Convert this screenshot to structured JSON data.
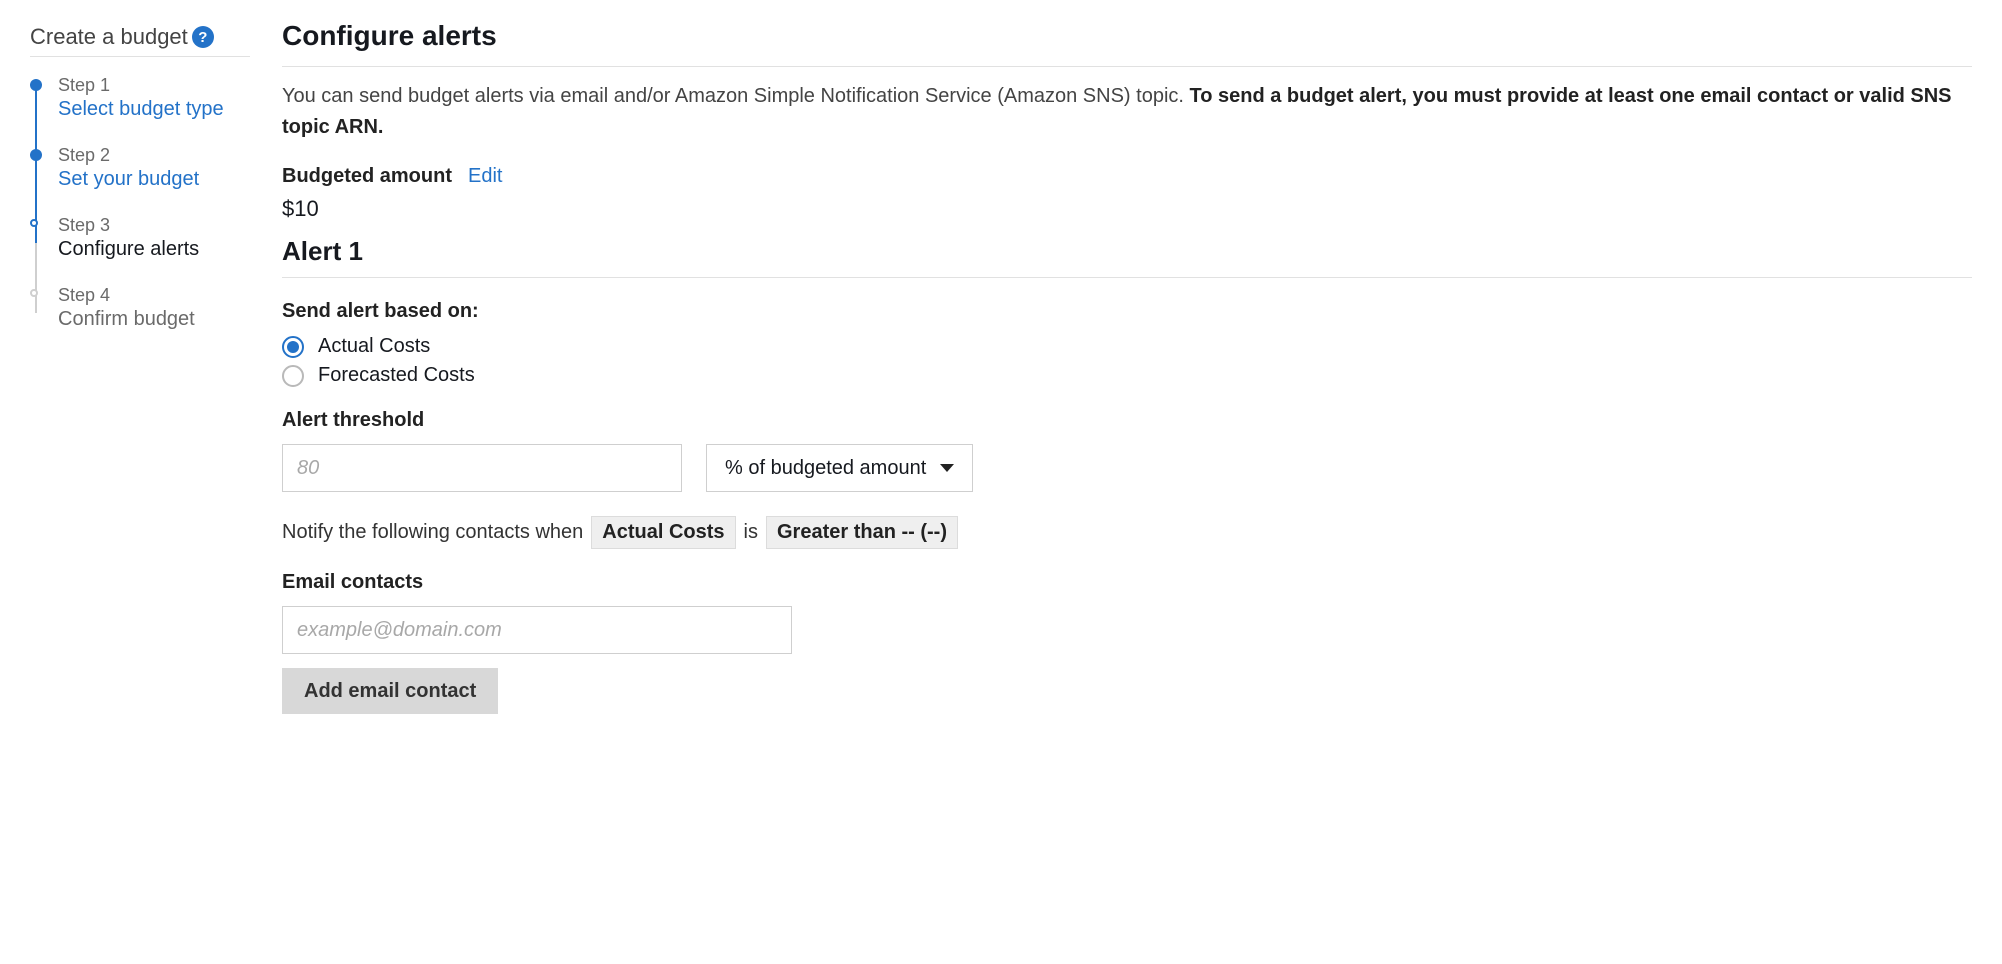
{
  "sidebar": {
    "title": "Create a budget",
    "steps": [
      {
        "label": "Step 1",
        "title": "Select budget type",
        "state": "done"
      },
      {
        "label": "Step 2",
        "title": "Set your budget",
        "state": "done"
      },
      {
        "label": "Step 3",
        "title": "Configure alerts",
        "state": "current"
      },
      {
        "label": "Step 4",
        "title": "Confirm budget",
        "state": "upcoming"
      }
    ]
  },
  "page": {
    "title": "Configure alerts",
    "desc_normal": "You can send budget alerts via email and/or Amazon Simple Notification Service (Amazon SNS) topic. ",
    "desc_bold": "To send a budget alert, you must provide at least one email contact or valid SNS topic ARN.",
    "budget_label": "Budgeted amount",
    "edit": "Edit",
    "budget_amount": "$10"
  },
  "alert": {
    "title": "Alert 1",
    "basis_label": "Send alert based on:",
    "radios": [
      {
        "label": "Actual Costs",
        "checked": true
      },
      {
        "label": "Forecasted Costs",
        "checked": false
      }
    ],
    "threshold_label": "Alert threshold",
    "threshold_placeholder": "80",
    "threshold_unit": "% of budgeted amount",
    "notify_prefix": "Notify the following contacts when",
    "notify_chip1": "Actual Costs",
    "notify_mid": "is",
    "notify_chip2": "Greater than -- (--)",
    "email_label": "Email contacts",
    "email_placeholder": "example@domain.com",
    "add_button": "Add email contact"
  }
}
